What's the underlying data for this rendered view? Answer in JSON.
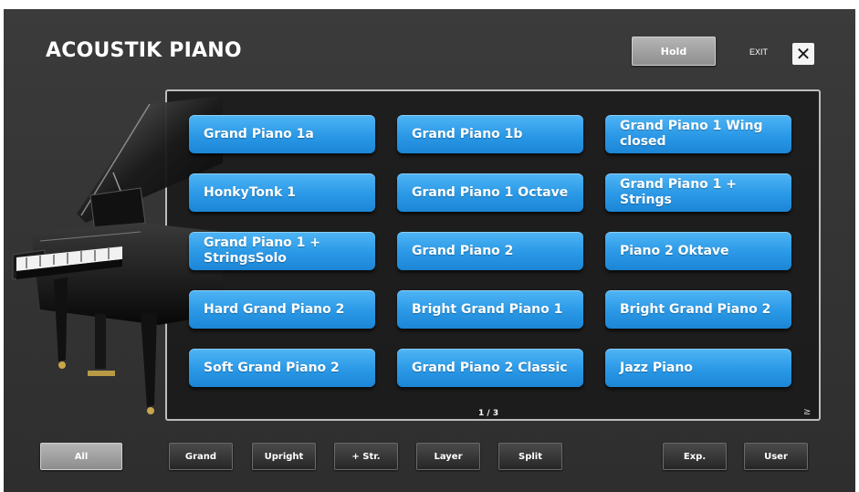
{
  "header": {
    "title": "ACOUSTIK PIANO",
    "hold_label": "Hold",
    "exit_label": "EXIT",
    "close_glyph": "✕"
  },
  "voices": [
    {
      "label": "Grand Piano 1a"
    },
    {
      "label": "Grand Piano 1b"
    },
    {
      "label": "Grand Piano 1 Wing closed"
    },
    {
      "label": "HonkyTonk 1"
    },
    {
      "label": "Grand Piano 1 Octave"
    },
    {
      "label": "Grand Piano 1 + Strings"
    },
    {
      "label": "Grand Piano 1 + StringsSolo"
    },
    {
      "label": "Grand Piano 2"
    },
    {
      "label": "Piano 2 Oktave"
    },
    {
      "label": "Hard Grand Piano 2"
    },
    {
      "label": "Bright Grand Piano 1"
    },
    {
      "label": "Bright Grand Piano 2"
    },
    {
      "label": "Soft Grand Piano 2"
    },
    {
      "label": "Grand Piano 2 Classic"
    },
    {
      "label": "Jazz Piano"
    }
  ],
  "pager": {
    "page": "1 / 3",
    "next_glyph": "≥"
  },
  "filters": {
    "all": "All",
    "grand": "Grand",
    "upright": "Upright",
    "strings": "+ Str.",
    "layer": "Layer",
    "split": "Split",
    "expansion": "Exp.",
    "user": "User"
  },
  "colors": {
    "voice_button": "#2a98e6",
    "background": "#353535",
    "active_filter": "#a5a5a5"
  },
  "icons": {
    "close": "close-icon",
    "next_page": "chevron-right-icon",
    "piano": "grand-piano-image"
  }
}
